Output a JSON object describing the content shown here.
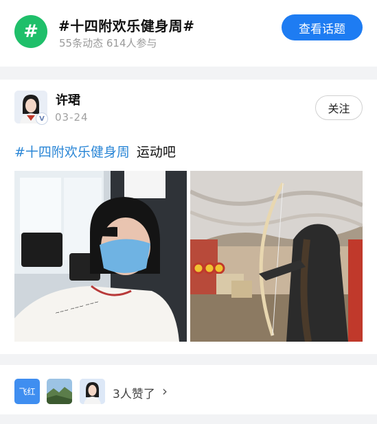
{
  "topic": {
    "icon_symbol": "#",
    "icon_color": "#1fbf6a",
    "title": "#十四附欢乐健身周#",
    "stats": "55条动态 614人参与",
    "view_button": "查看话题",
    "button_color": "#1e7cf2"
  },
  "post": {
    "author": "许珺",
    "date": "03-24",
    "follow_button": "关注",
    "hashtag": "#十四附欢乐健身周",
    "body": "运动吧",
    "hashtag_color": "#2a86d6",
    "images": [
      "selfie-photo-at-gym",
      "archery-photo"
    ]
  },
  "likes": {
    "avatar_1_text": "飞红",
    "summary": "3人赞了",
    "chevron": "›"
  }
}
